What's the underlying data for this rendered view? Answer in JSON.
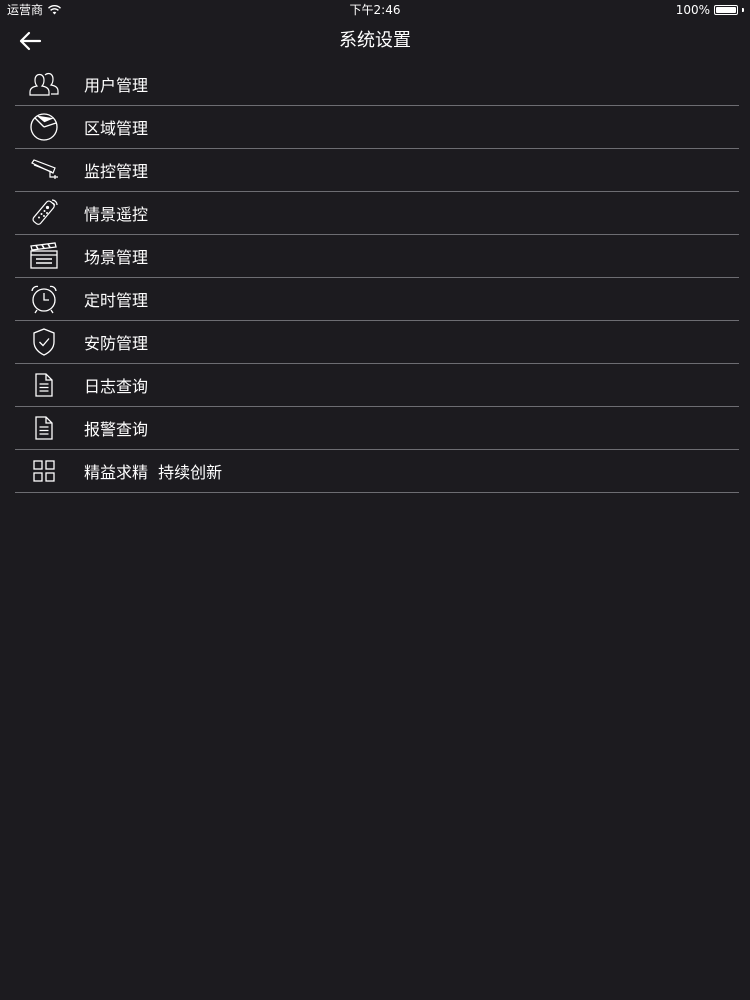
{
  "status_bar": {
    "carrier": "运营商",
    "time": "下午2:46",
    "battery": "100%"
  },
  "nav": {
    "title": "系统设置",
    "back_icon": "arrow-left-icon"
  },
  "menu": {
    "items": [
      {
        "label": "用户管理",
        "icon": "users-icon"
      },
      {
        "label": "区域管理",
        "icon": "pie-chart-icon"
      },
      {
        "label": "监控管理",
        "icon": "security-camera-icon"
      },
      {
        "label": "情景遥控",
        "icon": "remote-control-icon"
      },
      {
        "label": "场景管理",
        "icon": "clapperboard-icon"
      },
      {
        "label": "定时管理",
        "icon": "alarm-clock-icon"
      },
      {
        "label": "安防管理",
        "icon": "shield-check-icon"
      },
      {
        "label": "日志查询",
        "icon": "document-icon"
      },
      {
        "label": "报警查询",
        "icon": "document-icon"
      },
      {
        "label": "精益求精  持续创新",
        "icon": "grid-icon"
      }
    ]
  },
  "colors": {
    "background": "#1c1b1f",
    "separator": "#6d6d72",
    "text": "#ffffff"
  }
}
